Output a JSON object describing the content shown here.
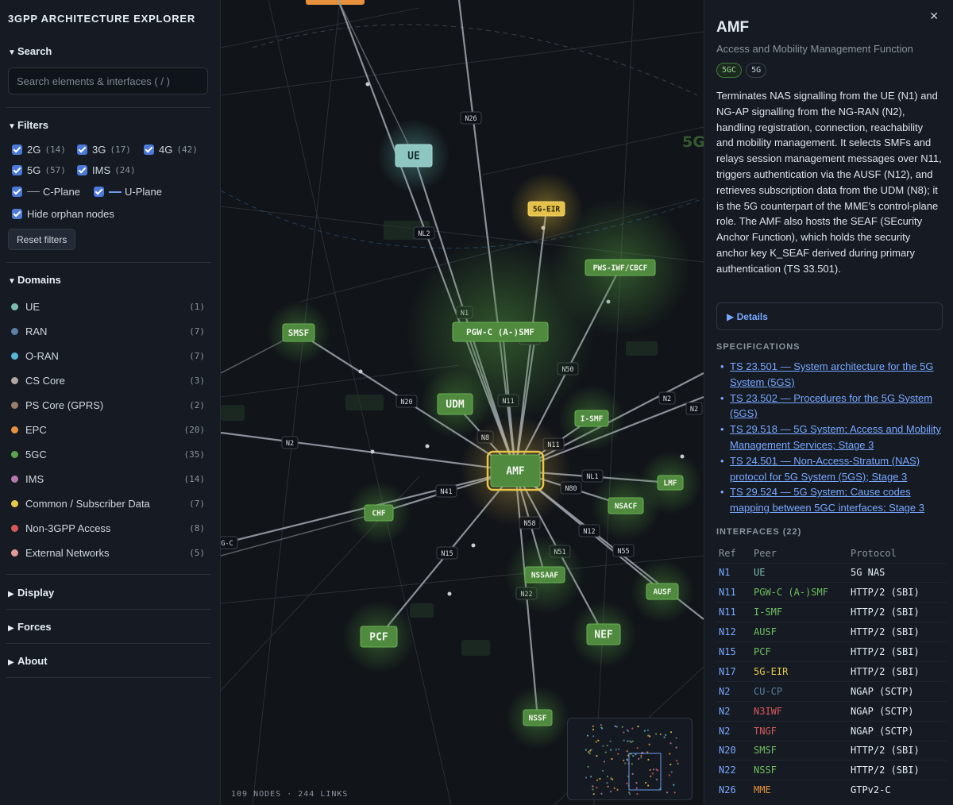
{
  "app": {
    "title": "3GPP ARCHITECTURE EXPLORER"
  },
  "sidebar": {
    "search": {
      "title": "Search",
      "placeholder": "Search elements & interfaces ( / )"
    },
    "filters": {
      "title": "Filters",
      "generations": [
        {
          "label": "2G",
          "count": "(14)"
        },
        {
          "label": "3G",
          "count": "(17)"
        },
        {
          "label": "4G",
          "count": "(42)"
        },
        {
          "label": "5G",
          "count": "(57)"
        },
        {
          "label": "IMS",
          "count": "(24)"
        }
      ],
      "planes": [
        {
          "label": "C-Plane",
          "color": "#9aa3ad"
        },
        {
          "label": "U-Plane",
          "color": "#6e9bea"
        }
      ],
      "orphan_label": "Hide orphan nodes",
      "reset_label": "Reset filters"
    },
    "domains": {
      "title": "Domains",
      "items": [
        {
          "label": "UE",
          "count": "(1)",
          "color": "#7cb9b1"
        },
        {
          "label": "RAN",
          "count": "(7)",
          "color": "#5b7fa6"
        },
        {
          "label": "O-RAN",
          "count": "(7)",
          "color": "#56b8d6"
        },
        {
          "label": "CS Core",
          "count": "(3)",
          "color": "#b0a8a0"
        },
        {
          "label": "PS Core (GPRS)",
          "count": "(2)",
          "color": "#9a7e6a"
        },
        {
          "label": "EPC",
          "count": "(20)",
          "color": "#e8913c"
        },
        {
          "label": "5GC",
          "count": "(35)",
          "color": "#5da34f"
        },
        {
          "label": "IMS",
          "count": "(14)",
          "color": "#b679ad"
        },
        {
          "label": "Common / Subscriber Data",
          "count": "(7)",
          "color": "#e7c74a"
        },
        {
          "label": "Non-3GPP Access",
          "count": "(8)",
          "color": "#d75a5a"
        },
        {
          "label": "External Networks",
          "count": "(5)",
          "color": "#e59a9a"
        }
      ]
    },
    "sections": {
      "display": "Display",
      "forces": "Forces",
      "about": "About"
    }
  },
  "graph": {
    "stats": "109 NODES · 244 LINKS",
    "region_label": "5G",
    "nodes": [
      {
        "id": "amf",
        "label": "AMF",
        "kind": "5gc"
      },
      {
        "id": "ue",
        "label": "UE",
        "kind": "ue"
      },
      {
        "id": "eir",
        "label": "5G-EIR",
        "kind": "common"
      },
      {
        "id": "pws",
        "label": "PWS-IWF/CBCF",
        "kind": "5gc"
      },
      {
        "id": "pgwc",
        "label": "PGW-C (A-)SMF",
        "kind": "5gc"
      },
      {
        "id": "smsf",
        "label": "SMSF",
        "kind": "5gc"
      },
      {
        "id": "udm",
        "label": "UDM",
        "kind": "5gc"
      },
      {
        "id": "ismf",
        "label": "I-SMF",
        "kind": "5gc"
      },
      {
        "id": "lmf",
        "label": "LMF",
        "kind": "5gc"
      },
      {
        "id": "nsacf",
        "label": "NSACF",
        "kind": "5gc"
      },
      {
        "id": "chf",
        "label": "CHF",
        "kind": "5gc"
      },
      {
        "id": "nssaaf",
        "label": "NSSAAF",
        "kind": "5gc"
      },
      {
        "id": "ausf",
        "label": "AUSF",
        "kind": "5gc"
      },
      {
        "id": "pcf",
        "label": "PCF",
        "kind": "5gc"
      },
      {
        "id": "nef",
        "label": "NEF",
        "kind": "5gc"
      },
      {
        "id": "nssf",
        "label": "NSSF",
        "kind": "5gc"
      },
      {
        "id": "tngf",
        "label": "TNGF",
        "kind": "n3gpp"
      },
      {
        "id": "n3iwf",
        "label": "N3IWF",
        "kind": "n3gpp"
      }
    ],
    "edge_labels": [
      "N26",
      "NL2",
      "N1",
      "N17",
      "N50",
      "N20",
      "N11",
      "N8",
      "N11",
      "N2",
      "N2",
      "N2",
      "NL1",
      "N80",
      "N41",
      "N58",
      "N12",
      "N51",
      "N55",
      "N15",
      "N22",
      "G-C"
    ]
  },
  "detail": {
    "title": "AMF",
    "subtitle": "Access and Mobility Management Function",
    "badges": [
      "5GC",
      "5G"
    ],
    "description": "Terminates NAS signalling from the UE (N1) and NG-AP signalling from the NG-RAN (N2), handling registration, connection, reachability and mobility management. It selects SMFs and relays session management messages over N11, triggers authentication via the AUSF (N12), and retrieves subscription data from the UDM (N8); it is the 5G counterpart of the MME's control-plane role. The AMF also hosts the SEAF (SEcurity Anchor Function), which holds the security anchor key K_SEAF derived during primary authentication (TS 33.501).",
    "details_label": "Details",
    "specs_title": "SPECIFICATIONS",
    "specs": [
      "TS 23.501 — System architecture for the 5G System (5GS)",
      "TS 23.502 — Procedures for the 5G System (5GS)",
      "TS 29.518 — 5G System; Access and Mobility Management Services; Stage 3",
      "TS 24.501 — Non-Access-Stratum (NAS) protocol for 5G System (5GS); Stage 3",
      "TS 29.524 — 5G System; Cause codes mapping between 5GC interfaces; Stage 3"
    ],
    "interfaces_title": "INTERFACES (22)",
    "interfaces_headers": [
      "Ref",
      "Peer",
      "Protocol"
    ],
    "interfaces": [
      {
        "ref": "N1",
        "peer": "UE",
        "protocol": "5G NAS",
        "color": "#7cb9b1"
      },
      {
        "ref": "N11",
        "peer": "PGW-C (A-)SMF",
        "protocol": "HTTP/2 (SBI)",
        "color": "#6fbf5e"
      },
      {
        "ref": "N11",
        "peer": "I-SMF",
        "protocol": "HTTP/2 (SBI)",
        "color": "#6fbf5e"
      },
      {
        "ref": "N12",
        "peer": "AUSF",
        "protocol": "HTTP/2 (SBI)",
        "color": "#6fbf5e"
      },
      {
        "ref": "N15",
        "peer": "PCF",
        "protocol": "HTTP/2 (SBI)",
        "color": "#6fbf5e"
      },
      {
        "ref": "N17",
        "peer": "5G-EIR",
        "protocol": "HTTP/2 (SBI)",
        "color": "#e7c74a"
      },
      {
        "ref": "N2",
        "peer": "CU-CP",
        "protocol": "NGAP (SCTP)",
        "color": "#5b7fa6"
      },
      {
        "ref": "N2",
        "peer": "N3IWF",
        "protocol": "NGAP (SCTP)",
        "color": "#d75a5a"
      },
      {
        "ref": "N2",
        "peer": "TNGF",
        "protocol": "NGAP (SCTP)",
        "color": "#d75a5a"
      },
      {
        "ref": "N20",
        "peer": "SMSF",
        "protocol": "HTTP/2 (SBI)",
        "color": "#6fbf5e"
      },
      {
        "ref": "N22",
        "peer": "NSSF",
        "protocol": "HTTP/2 (SBI)",
        "color": "#6fbf5e"
      },
      {
        "ref": "N26",
        "peer": "MME",
        "protocol": "GTPv2-C",
        "color": "#e8913c"
      }
    ]
  }
}
